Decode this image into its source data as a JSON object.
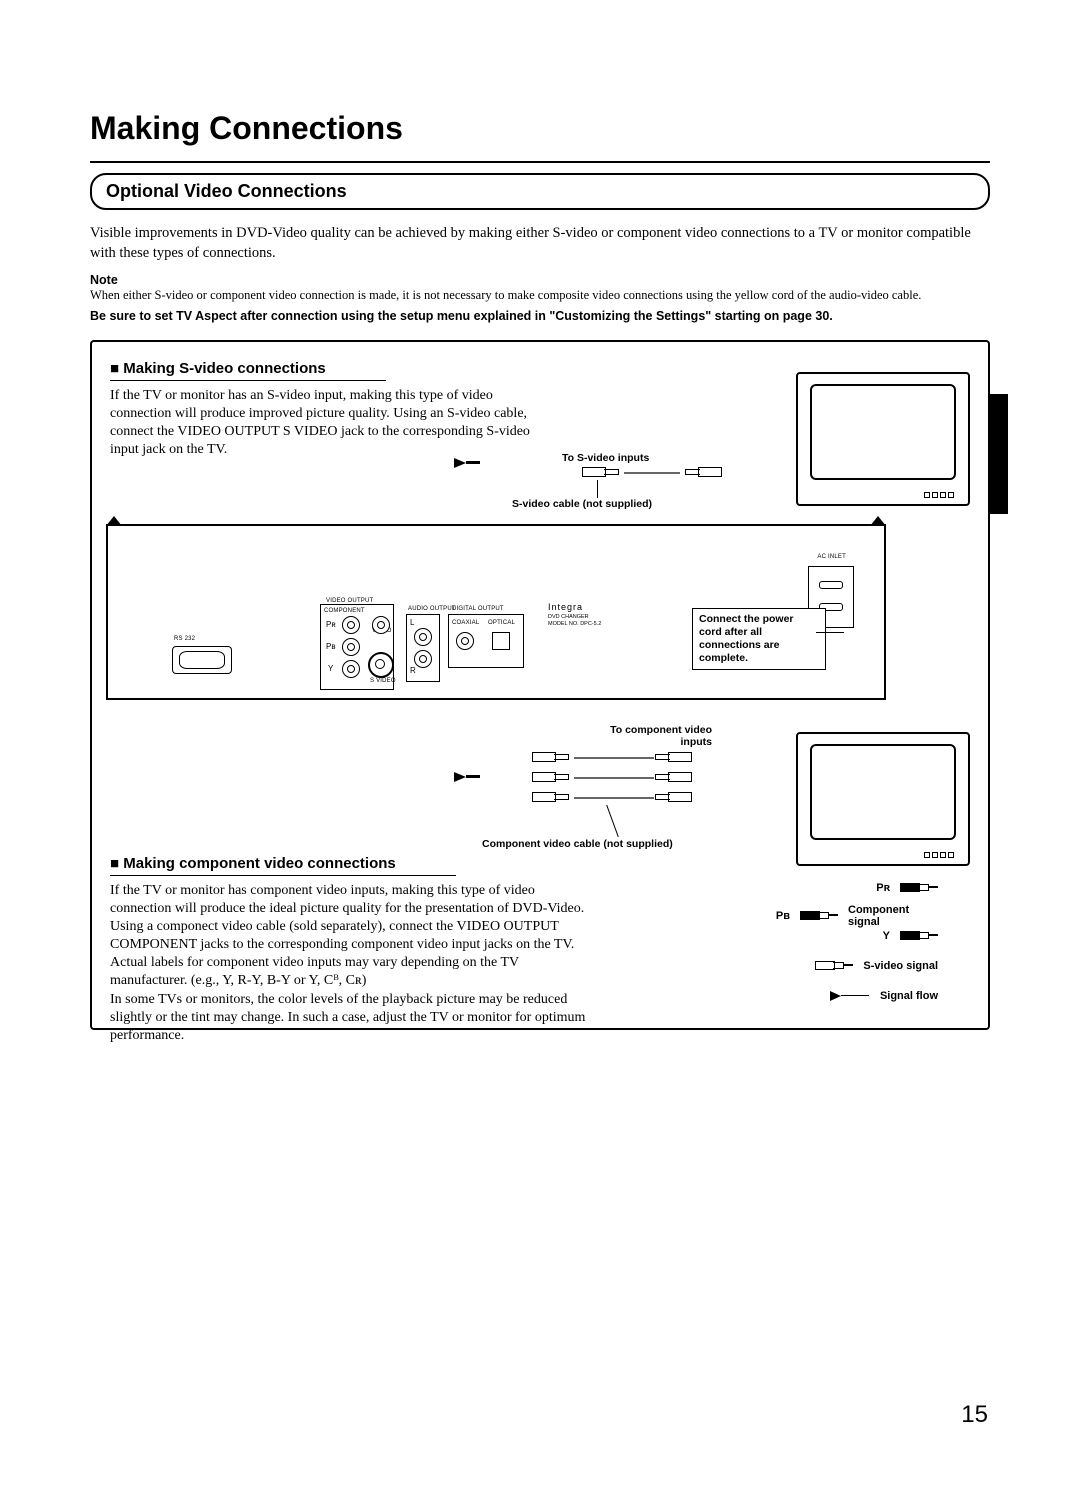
{
  "page_title": "Making Connections",
  "section_title": "Optional Video Connections",
  "intro": "Visible improvements in DVD-Video quality can be achieved by making either S-video or component video connections to a TV or monitor compatible with these types of connections.",
  "note_label": "Note",
  "note_body": "When either S-video or component video connection is made, it is not necessary to make composite video connections using the yellow cord of the audio-video cable.",
  "note_bold": "Be sure to set TV Aspect after connection using the setup menu explained in \"Customizing the Settings\" starting on page 30.",
  "svideo_heading": "Making S-video connections",
  "svideo_para": "If the TV or monitor has an S-video input, making this type of video connection will produce improved picture quality. Using an S-video cable, connect the VIDEO OUTPUT S VIDEO jack to the corresponding S-video input jack on the TV.",
  "label_to_svideo_inputs": "To S-video inputs",
  "label_svideo_cable": "S-video cable (not supplied)",
  "callout_power": "Connect the power cord after all connections are complete.",
  "label_to_component_inputs": "To component video inputs",
  "label_component_cable": "Component video cable (not supplied)",
  "component_heading": "Making component video connections",
  "component_para": "If the TV or monitor has component video inputs, making this type of video connection will produce the ideal picture quality for the presentation of DVD-Video. Using a componect video cable (sold separately), connect the VIDEO OUTPUT COMPONENT jacks to the corresponding component video input jacks on the TV.\nActual labels for component video inputs may vary depending on the TV manufacturer. (e.g., Y, R-Y, B-Y or Y, Cᴮ, Cʀ)\nIn some TVs or monitors, the color levels of the playback picture may be reduced slightly or the tint may change. In such a case, adjust the TV or monitor for optimum performance.",
  "legend": {
    "pr": "Pʀ",
    "pb": "Pʙ",
    "y": "Y",
    "component_signal": "Component signal",
    "svideo_signal": "S-video signal",
    "signal_flow": "Signal flow"
  },
  "rear_panel": {
    "video_output": "VIDEO OUTPUT",
    "component": "COMPONENT",
    "pr": "Pʀ",
    "pb": "Pʙ",
    "y": "Y",
    "video": "VIDEO",
    "svideo": "S VIDEO",
    "audio_output": "AUDIO OUTPUT",
    "digital_output": "DIGITAL OUTPUT",
    "coaxial": "COAXIAL",
    "optical": "OPTICAL",
    "rs232": "RS 232",
    "l": "L",
    "r": "R",
    "ac_inlet": "AC INLET",
    "brand": "Integra",
    "brand_sub1": "DVD CHANGER",
    "brand_sub2": "MODEL NO. DPC-5.2"
  },
  "page_number": "15"
}
